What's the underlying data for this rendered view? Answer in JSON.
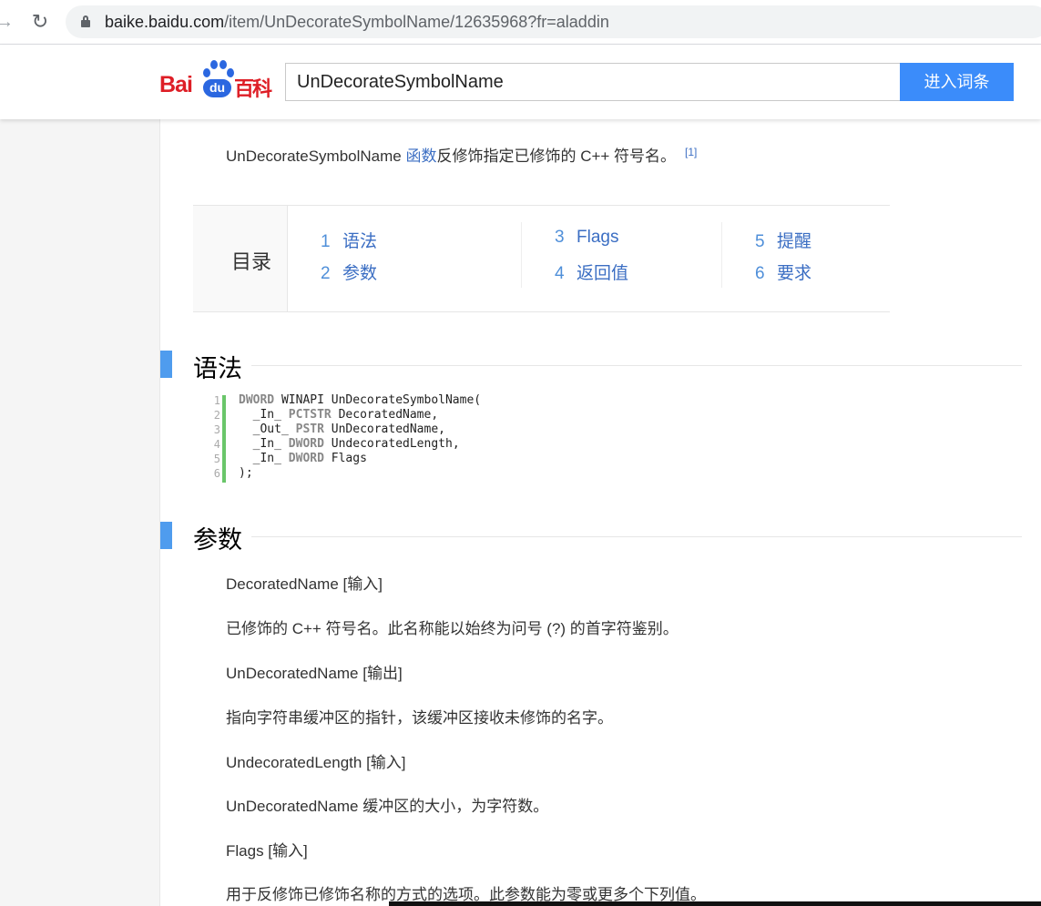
{
  "browser": {
    "url_host": "baike.baidu.com",
    "url_path": "/item/UnDecorateSymbolName/12635968?fr=aladdin"
  },
  "header": {
    "logo_bai": "Bai",
    "logo_du": "du",
    "logo_baike": "百科",
    "search_value": "UnDecorateSymbolName",
    "search_button": "进入词条"
  },
  "intro": {
    "text_before": "UnDecorateSymbolName ",
    "link": "函数",
    "text_after": "反修饰指定已修饰的 C++ 符号名。",
    "ref": "[1]"
  },
  "toc": {
    "title": "目录",
    "items": [
      {
        "num": "1",
        "label": "语法"
      },
      {
        "num": "2",
        "label": "参数"
      },
      {
        "num": "3",
        "label": "Flags"
      },
      {
        "num": "4",
        "label": "返回值"
      },
      {
        "num": "5",
        "label": "提醒"
      },
      {
        "num": "6",
        "label": "要求"
      }
    ]
  },
  "sections": {
    "syntax": "语法",
    "params": "参数"
  },
  "code": {
    "line_numbers": [
      "1",
      "2",
      "3",
      "4",
      "5",
      "6"
    ],
    "lines": [
      {
        "indent": "",
        "kw": "DWORD",
        "rest": " WINAPI UnDecorateSymbolName("
      },
      {
        "indent": "  _In_ ",
        "kw": "PCTSTR",
        "rest": " DecoratedName,"
      },
      {
        "indent": "  _Out_ ",
        "kw": "PSTR",
        "rest": " UnDecoratedName,"
      },
      {
        "indent": "  _In_ ",
        "kw": "DWORD",
        "rest": " UndecoratedLength,"
      },
      {
        "indent": "  _In_ ",
        "kw": "DWORD",
        "rest": " Flags"
      },
      {
        "indent": "",
        "kw": "",
        "rest": ");"
      }
    ]
  },
  "params": {
    "p1_name": "DecoratedName [输入]",
    "p1_desc": "已修饰的 C++ 符号名。此名称能以始终为问号 (?) 的首字符鉴别。",
    "p2_name": "UnDecoratedName [输出]",
    "p2_desc": "指向字符串缓冲区的指针，该缓冲区接收未修饰的名字。",
    "p3_name": "UndecoratedLength [输入]",
    "p3_desc": "UnDecoratedName 缓冲区的大小，为字符数。",
    "p4_name": "Flags [输入]",
    "p4_desc": "用于反修饰已修饰名称的方式的选项。此参数能为零或更多个下列值。"
  }
}
